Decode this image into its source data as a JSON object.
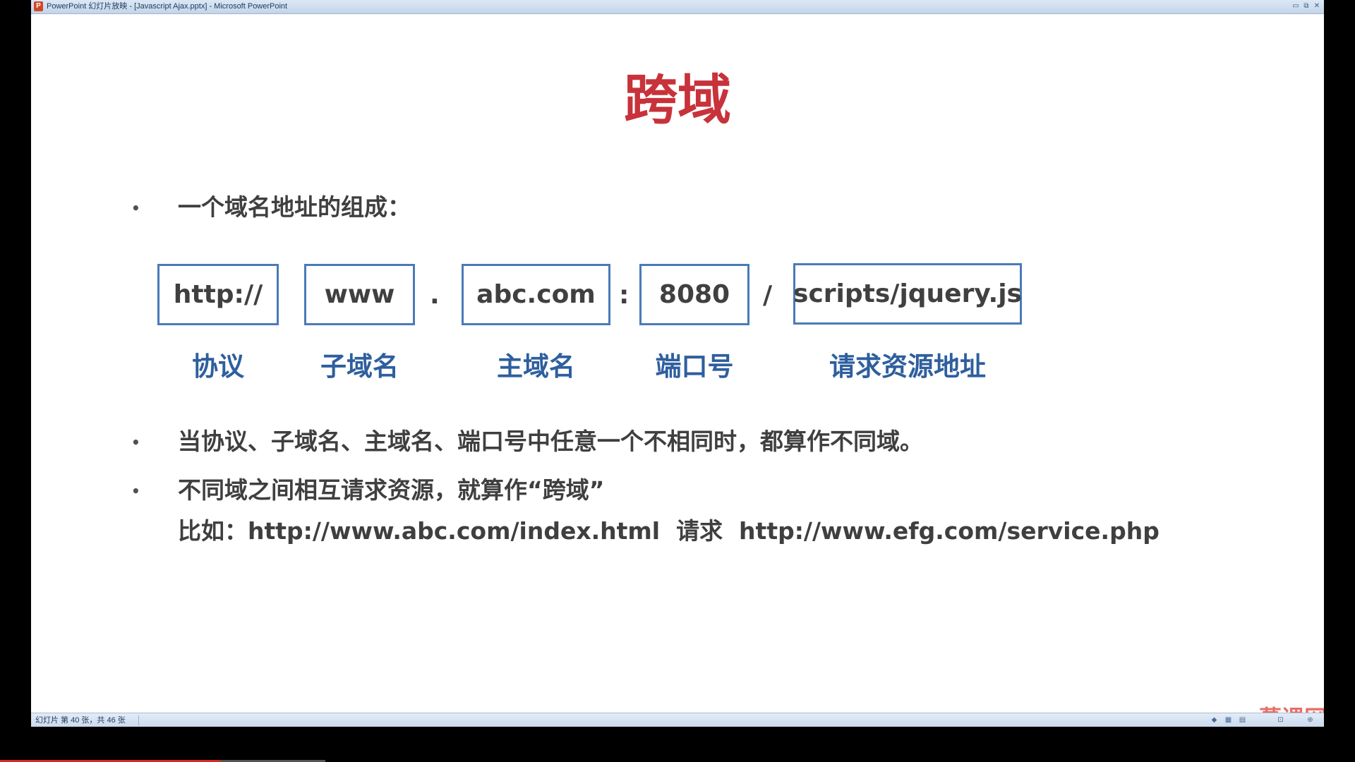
{
  "window": {
    "app_icon_letter": "P",
    "title": "PowerPoint 幻灯片放映 - [Javascript Ajax.pptx] - Microsoft PowerPoint",
    "buttons": {
      "minimize": "▭",
      "restore": "⧉",
      "close": "✕"
    }
  },
  "slide": {
    "title": "跨域",
    "bullet_glyph": "•",
    "bullet1": "一个域名地址的组成：",
    "url_parts": [
      {
        "text": "http://",
        "label": "协议"
      },
      {
        "text": "www",
        "label": "子域名"
      },
      {
        "text": "abc.com",
        "label": "主域名"
      },
      {
        "text": "8080",
        "label": "端口号"
      },
      {
        "text": "scripts/jquery.js",
        "label": "请求资源地址"
      }
    ],
    "separators": [
      ".",
      ":",
      "/"
    ],
    "bullet2": "当协议、子域名、主域名、端口号中任意一个不相同时，都算作不同域。",
    "bullet3": "不同域之间相互请求资源，就算作“跨域”",
    "example": "比如：http://www.abc.com/index.html  请求  http://www.efg.com/service.php"
  },
  "status": {
    "text": "幻灯片 第 40 张，共 46 张",
    "current_slide": 40,
    "total_slides": 46
  },
  "watermark": "慕课网",
  "video_progress": 0.2
}
